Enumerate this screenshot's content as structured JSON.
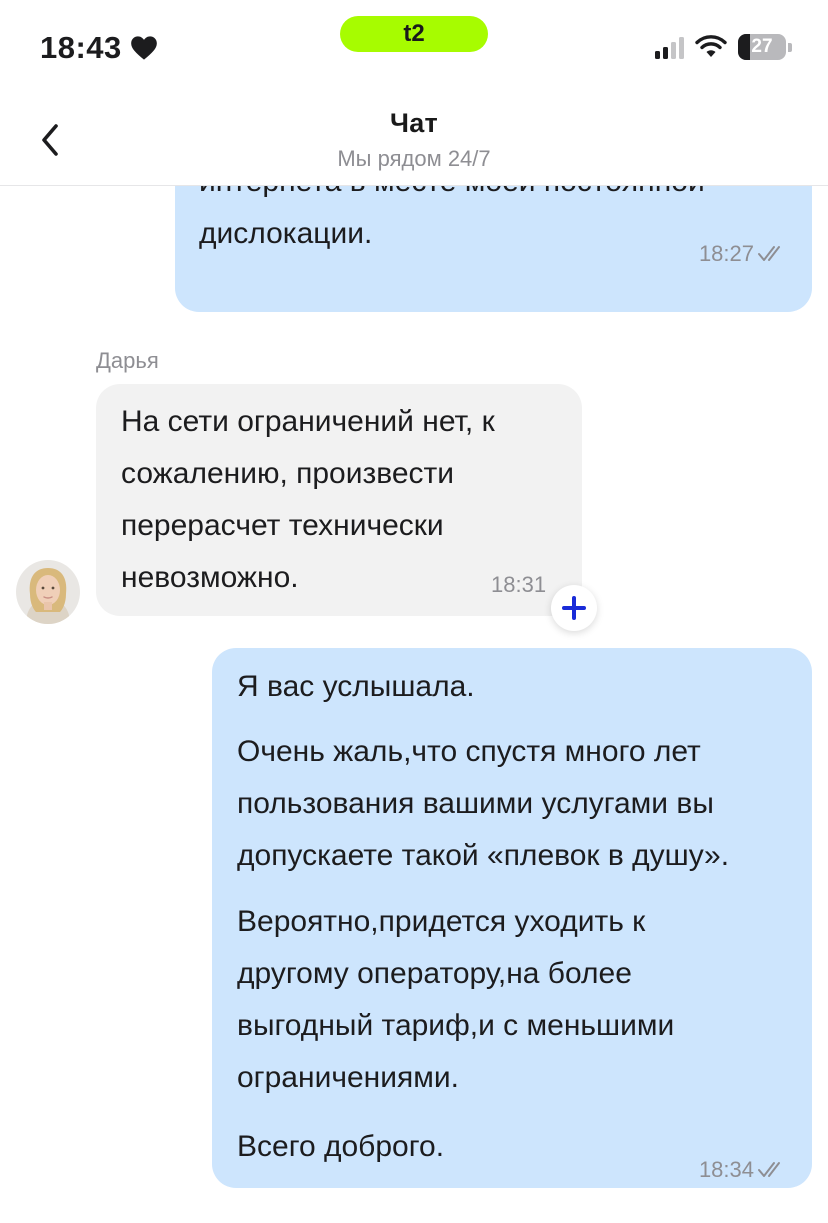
{
  "status_bar": {
    "time": "18:43",
    "carrier": "t2",
    "battery": "27",
    "icons": [
      "heart-icon",
      "signal-icon",
      "wifi-icon",
      "battery-icon"
    ]
  },
  "header": {
    "title": "Чат",
    "subtitle": "Мы рядом 24/7",
    "back_icon": "chevron-left-icon"
  },
  "messages": [
    {
      "direction": "outgoing",
      "lines": [
        "интернета в месте моей постоянной",
        "дислокации."
      ],
      "time": "18:27",
      "status_icon": "double-check-icon"
    },
    {
      "direction": "incoming",
      "sender": "Дарья",
      "lines": [
        "На сети ограничений нет, к",
        "сожалению, произвести",
        "перерасчет технически",
        "невозможно."
      ],
      "time": "18:31"
    },
    {
      "direction": "outgoing",
      "paragraphs": [
        [
          "Я вас услышала."
        ],
        [
          "Очень жаль,что спустя много лет",
          "пользования вашими услугами вы",
          "допускаете такой «плевок в душу»."
        ],
        [
          "Вероятно,придется уходить к",
          "другому оператору,на более",
          "выгодный тариф,и с меньшими",
          "ограничениями."
        ],
        [
          "Всего доброго."
        ]
      ],
      "time": "18:34",
      "status_icon": "double-check-icon"
    }
  ],
  "colors": {
    "carrier_accent": "#a7fc00",
    "outgoing_bubble": "#cde5fd",
    "incoming_bubble": "#f2f2f2",
    "reaction_plus": "#1a2bd8"
  }
}
